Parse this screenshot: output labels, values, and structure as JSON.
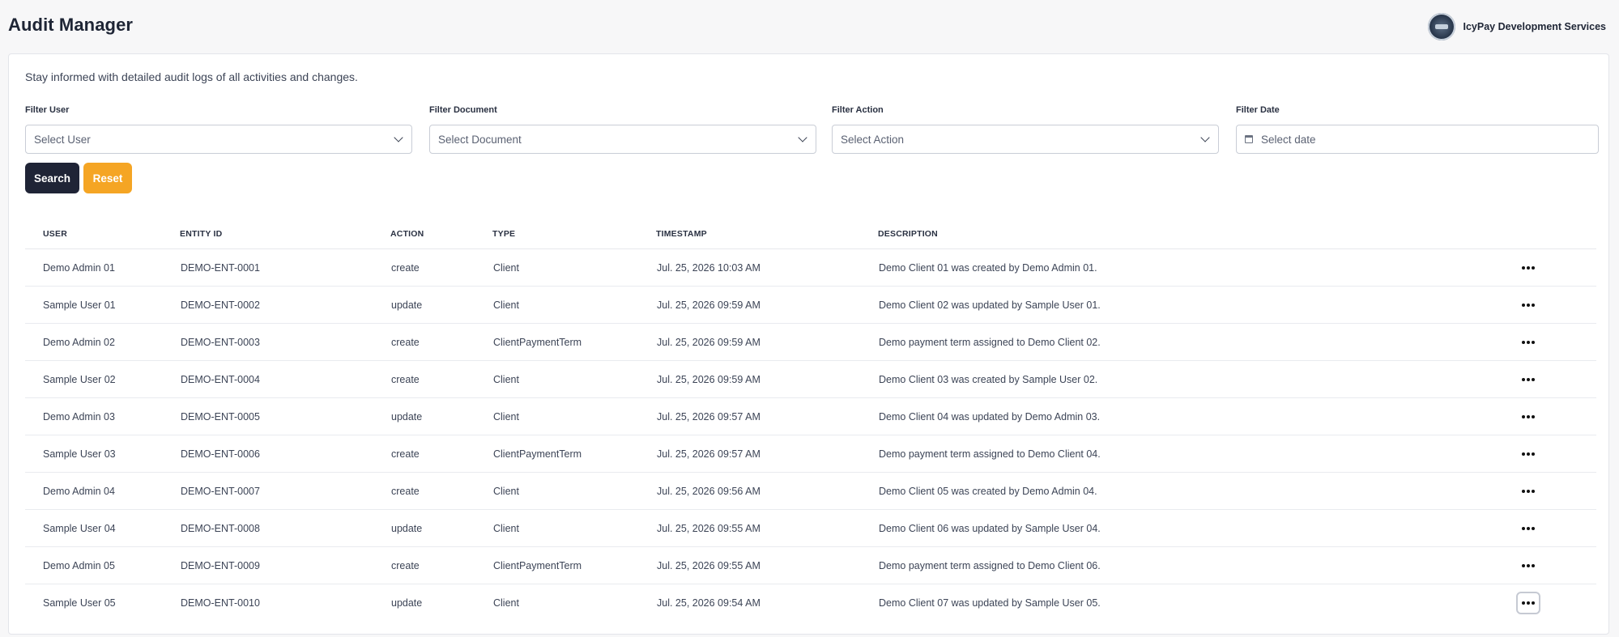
{
  "header": {
    "title": "Audit Manager",
    "org_name": "IcyPay Development Services"
  },
  "intro": "Stay informed with detailed audit logs of all activities and changes.",
  "filters": [
    {
      "label": "Filter User",
      "placeholder": "Select User",
      "kind": "select"
    },
    {
      "label": "Filter Document",
      "placeholder": "Select Document",
      "kind": "select"
    },
    {
      "label": "Filter Action",
      "placeholder": "Select Action",
      "kind": "select"
    },
    {
      "label": "Filter Date",
      "placeholder": "Select date",
      "kind": "date"
    }
  ],
  "buttons": {
    "search": "Search",
    "reset": "Reset"
  },
  "colors": {
    "search_bg": "#1f2436",
    "reset_bg": "#f5a524"
  },
  "table": {
    "headers": [
      "USER",
      "ENTITY ID",
      "ACTION",
      "TYPE",
      "TIMESTAMP",
      "DESCRIPTION"
    ],
    "rows": [
      {
        "user": "Demo Admin 01",
        "entity": "DEMO-ENT-0001",
        "action": "create",
        "type": "Client",
        "timestamp": "Jul. 25, 2026 10:03 AM",
        "description": "Demo Client 01 was created by Demo Admin 01."
      },
      {
        "user": "Sample User 01",
        "entity": "DEMO-ENT-0002",
        "action": "update",
        "type": "Client",
        "timestamp": "Jul. 25, 2026 09:59 AM",
        "description": "Demo Client 02 was updated by Sample User 01."
      },
      {
        "user": "Demo Admin 02",
        "entity": "DEMO-ENT-0003",
        "action": "create",
        "type": "ClientPaymentTerm",
        "timestamp": "Jul. 25, 2026 09:59 AM",
        "description": "Demo payment term assigned to Demo Client 02."
      },
      {
        "user": "Sample User 02",
        "entity": "DEMO-ENT-0004",
        "action": "create",
        "type": "Client",
        "timestamp": "Jul. 25, 2026 09:59 AM",
        "description": "Demo Client 03 was created by Sample User 02."
      },
      {
        "user": "Demo Admin 03",
        "entity": "DEMO-ENT-0005",
        "action": "update",
        "type": "Client",
        "timestamp": "Jul. 25, 2026 09:57 AM",
        "description": "Demo Client 04 was updated by Demo Admin 03."
      },
      {
        "user": "Sample User 03",
        "entity": "DEMO-ENT-0006",
        "action": "create",
        "type": "ClientPaymentTerm",
        "timestamp": "Jul. 25, 2026 09:57 AM",
        "description": "Demo payment term assigned to Demo Client 04."
      },
      {
        "user": "Demo Admin 04",
        "entity": "DEMO-ENT-0007",
        "action": "create",
        "type": "Client",
        "timestamp": "Jul. 25, 2026 09:56 AM",
        "description": "Demo Client 05 was created by Demo Admin 04."
      },
      {
        "user": "Sample User 04",
        "entity": "DEMO-ENT-0008",
        "action": "update",
        "type": "Client",
        "timestamp": "Jul. 25, 2026 09:55 AM",
        "description": "Demo Client 06 was updated by Sample User 04."
      },
      {
        "user": "Demo Admin 05",
        "entity": "DEMO-ENT-0009",
        "action": "create",
        "type": "ClientPaymentTerm",
        "timestamp": "Jul. 25, 2026 09:55 AM",
        "description": "Demo payment term assigned to Demo Client 06."
      },
      {
        "user": "Sample User 05",
        "entity": "DEMO-ENT-0010",
        "action": "update",
        "type": "Client",
        "timestamp": "Jul. 25, 2026 09:54 AM",
        "description": "Demo Client 07 was updated by Sample User 05."
      }
    ],
    "row_menu_icon": "more-horizontal-icon"
  }
}
